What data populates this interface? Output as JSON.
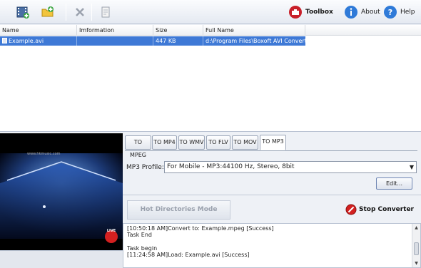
{
  "toolbar": {
    "add_video_icon": "film-add-icon",
    "add_folder_icon": "folder-add-icon",
    "remove_icon": "remove-icon",
    "clear_icon": "clear-list-icon",
    "toolbox_label": "Toolbox",
    "about_label": "About",
    "help_label": "Help"
  },
  "file_list": {
    "columns": [
      "Name",
      "Imformation",
      "Size",
      "Full Name"
    ],
    "rows": [
      {
        "name": "Example.avi",
        "information": "",
        "size": "447 KB",
        "full_name": "d:\\Program Files\\Boxoft AVI Convert..."
      }
    ]
  },
  "preview": {
    "watermark": "www.hkmusic.com",
    "live_badge": "LIVE"
  },
  "format_tabs": [
    "TO MPEG",
    "TO MP4",
    "TO WMV",
    "TO FLV",
    "TO MOV",
    "TO MP3"
  ],
  "active_tab": "TO MP3",
  "profile": {
    "label": "MP3 Profile:",
    "value": "For Mobile - MP3:44100 Hz, Stereo, 8bit"
  },
  "edit_label": "Edit...",
  "hot_directories_label": "Hot Directories Mode",
  "stop_label": "Stop Converter",
  "log": [
    "[10:50:18 AM]Convert to: Example.mpeg [Success]",
    "Task End",
    "",
    "Task begin",
    "[11:24:58 AM]Load: Example.avi [Success]"
  ],
  "colors": {
    "selection": "#3e79d6",
    "toolbox_red": "#c8202a",
    "info_blue": "#2f7ad8",
    "stop_red": "#d32020"
  }
}
